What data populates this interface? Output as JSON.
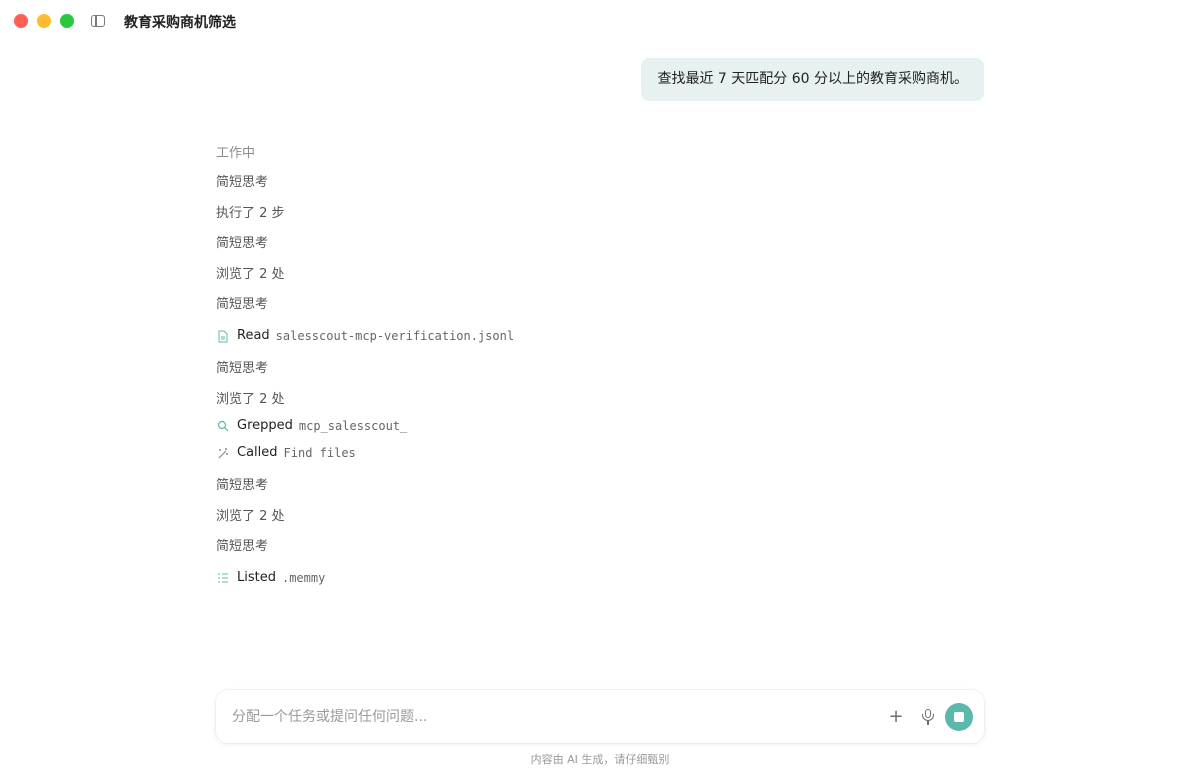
{
  "window": {
    "title": "教育采购商机筛选"
  },
  "conversation": {
    "user_message": "查找最近 7 天匹配分 60 分以上的教育采购商机。",
    "status": "工作中",
    "steps": [
      {
        "kind": "text",
        "label": "简短思考"
      },
      {
        "kind": "text",
        "label": "执行了 2 步"
      },
      {
        "kind": "text",
        "label": "简短思考"
      },
      {
        "kind": "text",
        "label": "浏览了 2 处"
      },
      {
        "kind": "text",
        "label": "简短思考"
      },
      {
        "kind": "tool",
        "icon": "document-icon",
        "verb": "Read",
        "arg": "salesscout-mcp-verification.jsonl"
      },
      {
        "kind": "text",
        "label": "简短思考"
      },
      {
        "kind": "text",
        "label": "浏览了 2 处"
      },
      {
        "kind": "tool",
        "icon": "search-icon",
        "verb": "Grepped",
        "arg": "mcp_salesscout_"
      },
      {
        "kind": "tool",
        "icon": "wand-icon",
        "verb": "Called",
        "arg": "Find files"
      },
      {
        "kind": "text",
        "label": "简短思考"
      },
      {
        "kind": "text",
        "label": "浏览了 2 处"
      },
      {
        "kind": "text",
        "label": "简短思考"
      },
      {
        "kind": "tool",
        "icon": "list-icon",
        "verb": "Listed",
        "arg": ".memmy"
      }
    ]
  },
  "composer": {
    "placeholder": "分配一个任务或提问任何问题...",
    "value": ""
  },
  "footer": {
    "disclaimer": "内容由 AI 生成，请仔细甄别"
  },
  "colors": {
    "accent": "#5cb8ac",
    "user_bubble": "#e7f1f1"
  }
}
